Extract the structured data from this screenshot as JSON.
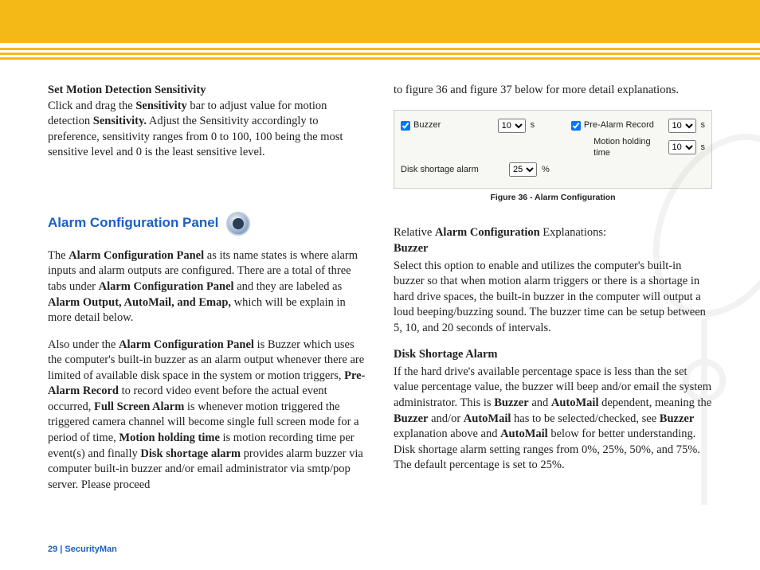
{
  "left": {
    "h1": "Set Motion Detection Sensitivity",
    "p1a": "Click and drag the ",
    "p1b": "Sensitivity",
    "p1c": " bar to adjust value for motion detection ",
    "p1d": "Sensitivity.",
    "p1e": " Adjust the Sensitivity accordingly to preference, sensitivity ranges from 0 to 100, 100 being the most sensitive level and 0 is the least sensitive level.",
    "heading": "Alarm Configuration Panel",
    "p2a": "The ",
    "p2b": "Alarm Configuration Panel",
    "p2c": " as its name states is where alarm inputs and alarm outputs are configured. There are a total of three tabs under ",
    "p2d": "Alarm Configuration Panel",
    "p2e": " and they are labeled as ",
    "p2f": "Alarm Output, AutoMail, and Emap,",
    "p2g": " which will be explain in more detail below.",
    "p3a": "Also under the ",
    "p3b": "Alarm Configuration Panel",
    "p3c": " is Buzzer which uses the computer's built-in buzzer as an alarm output whenever there are limited of available disk space in the system or motion triggers, ",
    "p3d": "Pre-Alarm Record",
    "p3e": " to record video event before the actual event occurred, ",
    "p3f": "Full Screen Alarm",
    "p3g": " is whenever motion triggered the triggered camera channel will become single full screen mode for a period of time, ",
    "p3h": "Motion holding time",
    "p3i": " is motion recording time per event(s) and finally ",
    "p3j": "Disk shortage alarm",
    "p3k": " provides alarm buzzer via computer built-in buzzer and/or email administrator via smtp/pop server.  Please proceed"
  },
  "right": {
    "top": "to figure 36 and figure 37 below for more detail explanations.",
    "fig": {
      "buzzer_label": "Buzzer",
      "buzzer_val": "10",
      "unit_s1": "s",
      "pre_label": "Pre-Alarm Record",
      "pre_val": "10",
      "unit_s2": "s",
      "motion_label": "Motion holding time",
      "motion_val": "10",
      "unit_s3": "s",
      "disk_label": "Disk shortage alarm",
      "disk_val": "25",
      "unit_pct": "%"
    },
    "caption": "Figure 36  - Alarm Configuration",
    "p1a": "Relative ",
    "p1b": "Alarm Configuration",
    "p1c": " Explanations:",
    "hbuzz": "Buzzer",
    "pBuzz": "Select this option to enable and utilizes the computer's built-in buzzer so that when motion alarm triggers or there is a shortage in hard drive spaces, the built-in buzzer in the computer will output a loud beeping/buzzing sound.  The buzzer time can be setup between 5, 10, and 20 seconds of intervals.",
    "hdisk": "Disk Shortage Alarm",
    "pDiska": "If the hard drive's available percentage space is less than the set value percentage value, the buzzer will beep and/or email the system administrator.  This is ",
    "pDiskb": "Buzzer",
    "pDiskc": " and ",
    "pDiskd": "AutoMail",
    "pDiske": " dependent, meaning the ",
    "pDiskf": "Buzzer",
    "pDiskg": " and/or ",
    "pDiskh": "AutoMail",
    "pDiski": " has to be selected/checked, see ",
    "pDiskj": "Buzzer",
    "pDiskk": " explanation above and ",
    "pDiskl": "AutoMail",
    "pDiskm": " below for better understanding.  Disk shortage alarm setting ranges from 0%, 25%, 50%, and 75%.  The default percentage is set to 25%."
  },
  "footer": "29  |  SecurityMan"
}
